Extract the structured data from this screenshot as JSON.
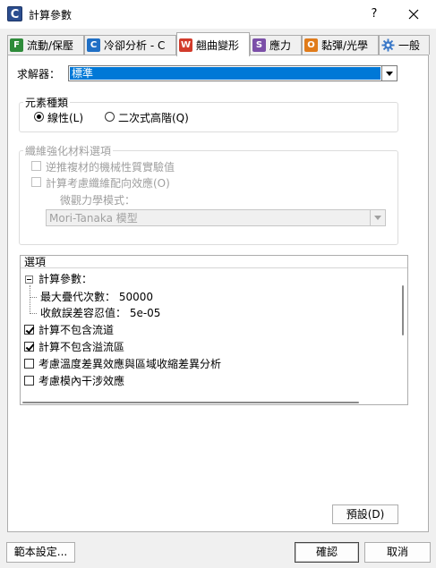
{
  "window": {
    "title": "計算參數",
    "help": "?",
    "close": "✕",
    "app_icon": "C"
  },
  "tabs": [
    {
      "label": "流動/保壓",
      "icon": "F",
      "color": "#2e8b3a",
      "active": false
    },
    {
      "label": "冷卻分析 - C",
      "icon": "C",
      "color": "#1f6fc5",
      "active": false
    },
    {
      "label": "翹曲變形",
      "icon": "W",
      "color": "#d23b2b",
      "active": true
    },
    {
      "label": "應力",
      "icon": "S",
      "color": "#7b4fa8",
      "active": false
    },
    {
      "label": "黏彈/光學",
      "icon": "O",
      "color": "#e07b1a",
      "active": false
    },
    {
      "label": "一般",
      "icon": "gear-icon",
      "color": "#3a78c8",
      "active": false
    }
  ],
  "solver": {
    "label": "求解器：",
    "value": "標準"
  },
  "element_type": {
    "legend": "元素種類",
    "options": [
      "線性(L)",
      "二次式高階(Q)"
    ],
    "selected": 0
  },
  "fiber": {
    "legend": "纖維強化材料選項",
    "checkbox1": "逆推複材的機械性質實驗值",
    "checkbox2": "計算考慮纖維配向效應(O)",
    "model_label": "微觀力學模式：",
    "model_value": "Mori-Tanaka 模型"
  },
  "options": {
    "header": "選項",
    "params_label": "計算參數：",
    "max_iter": "最大疊代次數： 50000",
    "tolerance": "收斂誤差容忍值： 5e-05",
    "items": [
      {
        "label": "計算不包含流道",
        "checked": true
      },
      {
        "label": "計算不包含溢流區",
        "checked": true
      },
      {
        "label": "考慮溫度差異效應與區域收縮差異分析",
        "checked": false
      },
      {
        "label": "考慮模內干涉效應",
        "checked": false
      }
    ]
  },
  "buttons": {
    "default": "預設(D)",
    "template": "範本設定...",
    "ok": "確認",
    "cancel": "取消"
  }
}
